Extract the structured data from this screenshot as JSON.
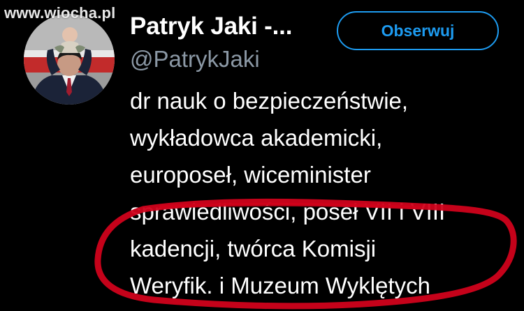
{
  "watermark": "www.wiocha.pl",
  "profile": {
    "display_name": "Patryk Jaki -...",
    "handle": "@PatrykJaki",
    "follow_label": "Obserwuj",
    "bio_lines": [
      "dr nauk o bezpieczeństwie,",
      "wykładowca akademicki,",
      "europoseł, wiceminister",
      "sprawiedliwości, poseł VII i VIII",
      "kadencji, twórca Komisji",
      "Weryfik. i Muzeum Wyklętych"
    ]
  },
  "colors": {
    "background": "#000000",
    "text": "#ffffff",
    "handle": "#8b98a5",
    "accent": "#1d9bf0",
    "annotation": "#d0021b"
  },
  "icons": {
    "avatar": "profile-photo",
    "annotation": "hand-drawn-red-ellipse"
  }
}
